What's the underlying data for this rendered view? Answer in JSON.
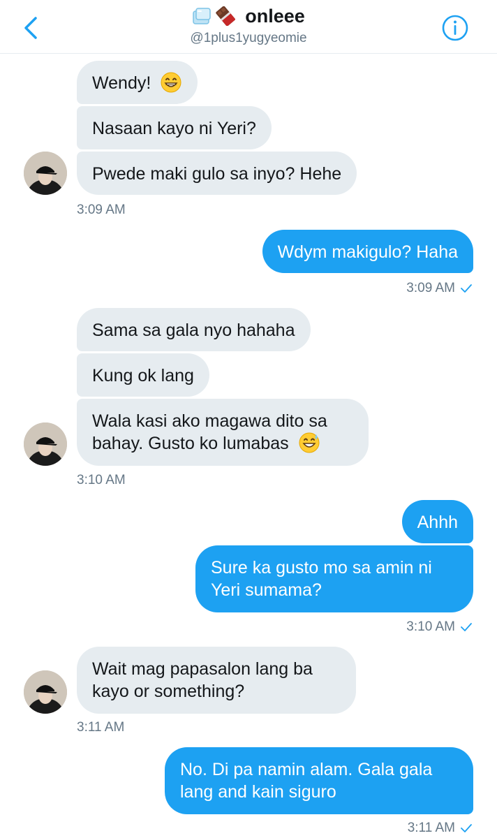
{
  "header": {
    "title": "onleee",
    "handle": "@1plus1yugyeomie"
  },
  "colors": {
    "accent": "#1da1f2",
    "incoming_bubble": "#e6ecf0",
    "secondary_text": "#657786"
  },
  "icons": {
    "back": "chevron-left-icon",
    "info": "info-circle-icon",
    "read": "checkmark-icon"
  },
  "messages": [
    {
      "dir": "in",
      "text": "Wendy!",
      "emoji": "grinning-face"
    },
    {
      "dir": "in",
      "text": "Nasaan kayo ni Yeri?"
    },
    {
      "dir": "in",
      "text": "Pwede maki gulo sa inyo? Hehe"
    },
    {
      "dir": "in",
      "time": "3:09 AM"
    },
    {
      "dir": "out",
      "text": "Wdym makigulo? Haha"
    },
    {
      "dir": "out",
      "time": "3:09 AM"
    },
    {
      "dir": "in",
      "text": "Sama sa gala nyo hahaha"
    },
    {
      "dir": "in",
      "text": "Kung ok lang"
    },
    {
      "dir": "in",
      "text_line1": "Wala kasi ako magawa dito sa",
      "text_line2": "bahay. Gusto ko lumabas",
      "emoji": "grinning-sweat"
    },
    {
      "dir": "in",
      "time": "3:10 AM"
    },
    {
      "dir": "out",
      "text": "Ahhh"
    },
    {
      "dir": "out",
      "text": "Sure ka gusto mo sa amin ni Yeri sumama?"
    },
    {
      "dir": "out",
      "time": "3:10 AM"
    },
    {
      "dir": "in",
      "text": "Wait mag papasalon lang ba kayo or something?"
    },
    {
      "dir": "in",
      "time": "3:11 AM"
    },
    {
      "dir": "out",
      "text": "No. Di pa namin alam. Gala gala lang and kain siguro"
    },
    {
      "dir": "out",
      "time": "3:11 AM"
    }
  ]
}
